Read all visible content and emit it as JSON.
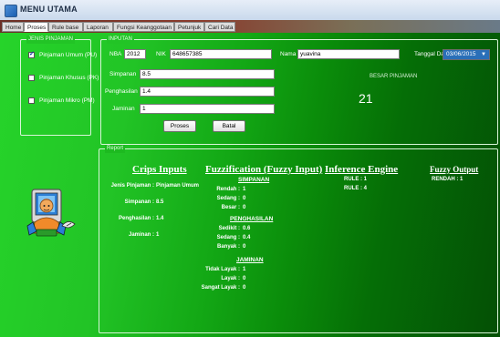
{
  "window": {
    "title": "MENU UTAMA"
  },
  "tabs": [
    "Home",
    "Proses",
    "Rule base",
    "Laporan",
    "Fungsi Keanggotaan",
    "Petunjuk",
    "Cari Data"
  ],
  "active_tab": "Proses",
  "jenis_pinjaman": {
    "legend": "JENIS PINJAMAN",
    "options": [
      {
        "label": "Pinjaman Umum (PU)",
        "checked": true
      },
      {
        "label": "Pinjaman Khusus (PK)",
        "checked": false
      },
      {
        "label": "Pinjaman Mikro (PM)",
        "checked": false
      }
    ]
  },
  "inputan": {
    "legend": "INPUTAN",
    "nba_label": "NBA",
    "nba_value": "2012",
    "nik_label": "NIK",
    "nik_value": "648657385",
    "nama_label": "Nama",
    "nama_value": "yuavina",
    "tanggal_label": "Tanggal Data",
    "tanggal_value": "03/06/2015",
    "simpanan_label": "Simpanan",
    "simpanan_value": "8.5",
    "penghasilan_label": "Penghasilan",
    "penghasilan_value": "1.4",
    "jaminan_label": "Jaminan",
    "jaminan_value": "1",
    "besar_pinjaman_label": "BESAR PINJAMAN",
    "besar_pinjaman_value": "21",
    "proses_button": "Proses",
    "batal_button": "Batal"
  },
  "report": {
    "legend": "Report",
    "crips": {
      "title": "Crips Inputs",
      "rows": [
        {
          "label": "Jenis Pinjaman :",
          "value": "Pinjaman Umum"
        },
        {
          "label": "Simpanan :",
          "value": "8.5"
        },
        {
          "label": "Penghasilan :",
          "value": "1.4"
        },
        {
          "label": "Jaminan :",
          "value": "1"
        }
      ]
    },
    "fuzzification": {
      "title": "Fuzzification (Fuzzy Input)",
      "simpanan_title": "SIMPANAN",
      "simpanan_rows": [
        {
          "label": "Rendah :",
          "value": "1"
        },
        {
          "label": "Sedang :",
          "value": "0"
        },
        {
          "label": "Besar :",
          "value": "0"
        }
      ],
      "penghasilan_title": "PENGHASILAN",
      "penghasilan_rows": [
        {
          "label": "Sedikit :",
          "value": "0.6"
        },
        {
          "label": "Sedang :",
          "value": "0.4"
        },
        {
          "label": "Banyak :",
          "value": "0"
        }
      ],
      "jaminan_title": "JAMINAN",
      "jaminan_rows": [
        {
          "label": "Tidak Layak :",
          "value": "1"
        },
        {
          "label": "Layak :",
          "value": "0"
        },
        {
          "label": "Sangat Layak :",
          "value": "0"
        }
      ]
    },
    "inference": {
      "title": "Inference Engine",
      "rows": [
        "RULE : 1",
        "RULE : 4"
      ]
    },
    "output": {
      "title": "Fuzzy Output",
      "value": "RENDAH : 1"
    }
  }
}
